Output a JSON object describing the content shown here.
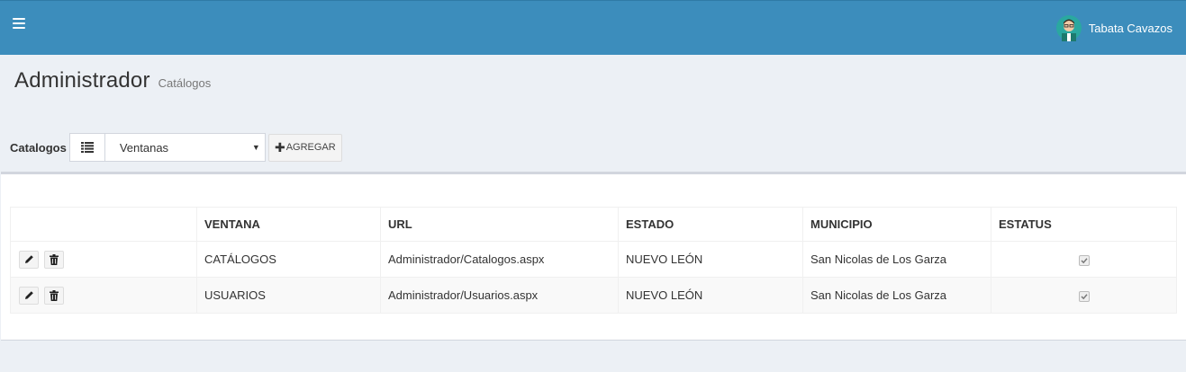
{
  "header": {
    "user_name": "Tabata Cavazos"
  },
  "page": {
    "title": "Administrador",
    "subtitle": "Catálogos"
  },
  "toolbar": {
    "label": "Catalogos",
    "select_value": "Ventanas",
    "add_label": "AGREGAR"
  },
  "table": {
    "columns": [
      "",
      "VENTANA",
      "URL",
      "ESTADO",
      "MUNICIPIO",
      "ESTATUS"
    ],
    "rows": [
      {
        "ventana": "CATÁLOGOS",
        "url": "Administrador/Catalogos.aspx",
        "estado": "NUEVO LEÓN",
        "municipio": "San Nicolas de Los Garza",
        "estatus": true
      },
      {
        "ventana": "USUARIOS",
        "url": "Administrador/Usuarios.aspx",
        "estado": "NUEVO LEÓN",
        "municipio": "San Nicolas de Los Garza",
        "estatus": true
      }
    ]
  },
  "colors": {
    "header_bg": "#3c8dbc",
    "page_bg": "#ecf0f5"
  }
}
